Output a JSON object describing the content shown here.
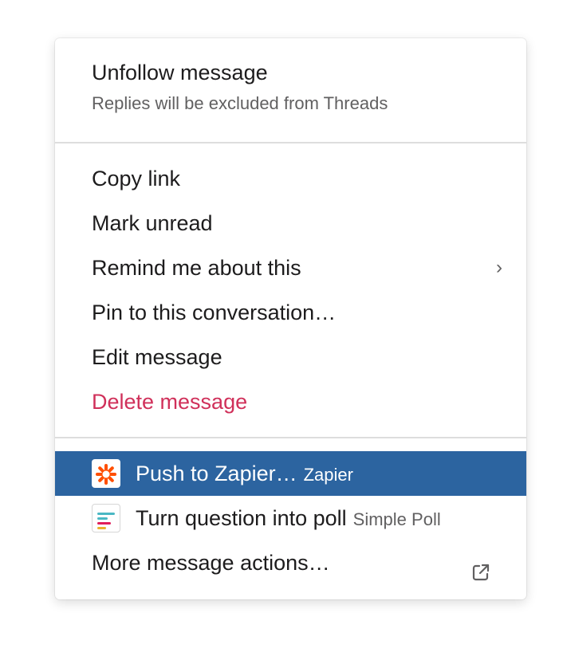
{
  "menu": {
    "header": {
      "title": "Unfollow message",
      "subtitle": "Replies will be excluded from Threads"
    },
    "items": [
      {
        "label": "Copy link"
      },
      {
        "label": "Mark unread"
      },
      {
        "label": "Remind me about this",
        "submenu_icon": "chevron-right-icon"
      },
      {
        "label": "Pin to this conversation…"
      },
      {
        "label": "Edit message"
      },
      {
        "label": "Delete message",
        "color": "#d0305a"
      }
    ],
    "app_actions": [
      {
        "label": "Push to Zapier…",
        "app": "Zapier",
        "icon": "zapier-icon",
        "selected": true,
        "color": "#ff4f00"
      },
      {
        "label": "Turn question into poll",
        "app": "Simple Poll",
        "icon": "simple-poll-icon",
        "selected": false
      }
    ],
    "more": {
      "label": "More message actions…",
      "icon": "external-link-icon"
    }
  },
  "colors": {
    "highlight": "#2c64a0",
    "danger": "#d0305a",
    "divider": "#dddddd"
  }
}
